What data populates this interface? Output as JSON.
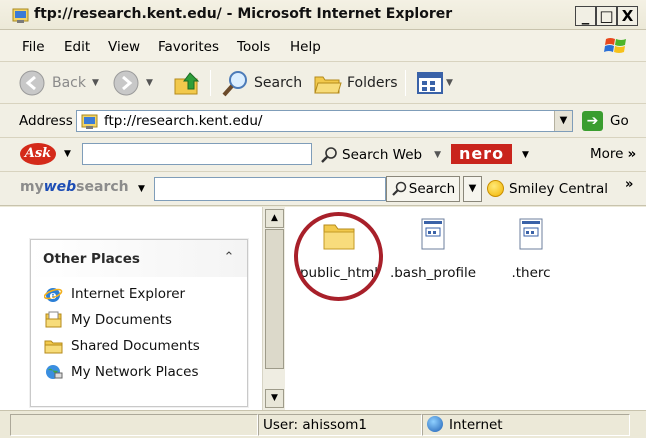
{
  "window": {
    "title": "ftp://research.kent.edu/ - Microsoft Internet Explorer",
    "minimize": "_",
    "maximize": "□",
    "close": "X"
  },
  "menu": [
    "File",
    "Edit",
    "View",
    "Favorites",
    "Tools",
    "Help"
  ],
  "toolbar": {
    "back": "Back",
    "search": "Search",
    "folders": "Folders"
  },
  "address": {
    "label": "Address",
    "url": "ftp://research.kent.edu/",
    "go": "Go"
  },
  "askbar": {
    "logo": "Ask",
    "search_web": "Search Web",
    "nero": "nero",
    "more": "More"
  },
  "mywebsearch": {
    "logo_prefix": "my",
    "logo_web": "web",
    "logo_suffix": "search",
    "search_button": "Search",
    "smiley": "Smiley Central"
  },
  "other_places": {
    "title": "Other Places",
    "items": [
      {
        "label": "Internet Explorer",
        "icon": "ie-icon"
      },
      {
        "label": "My Documents",
        "icon": "my-documents-icon"
      },
      {
        "label": "Shared Documents",
        "icon": "folder-icon"
      },
      {
        "label": "My Network Places",
        "icon": "network-places-icon"
      }
    ]
  },
  "files": [
    {
      "name": "public_html",
      "type": "folder",
      "highlighted": true
    },
    {
      "name": ".bash_profile",
      "type": "file"
    },
    {
      "name": ".therc",
      "type": "file"
    }
  ],
  "status": {
    "user": "User: ahissom1",
    "zone": "Internet"
  },
  "colors": {
    "highlight_circle": "#a8202a",
    "window_bg": "#ece9d8",
    "nero_red": "#c9241c",
    "go_green": "#3a9d2f"
  }
}
